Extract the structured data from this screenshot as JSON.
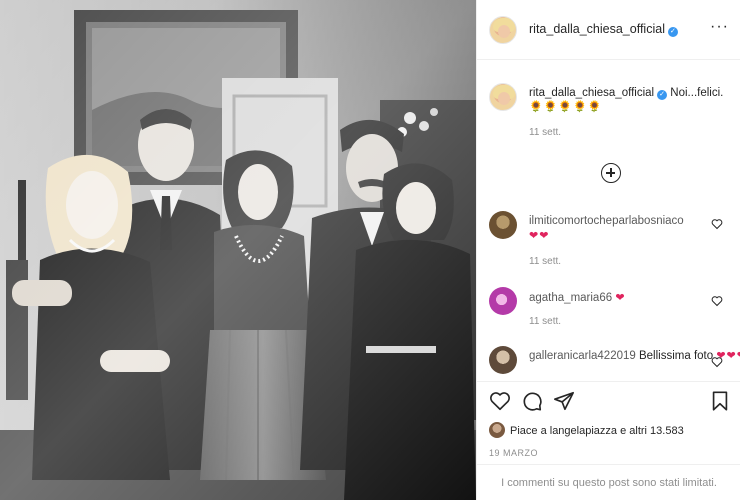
{
  "post": {
    "photo_alt_subjects": "",
    "header": {
      "username": "rita_dalla_chiesa_official",
      "more_icon": "more-horizontal-icon"
    },
    "caption": {
      "username": "rita_dalla_chiesa_official",
      "text": "Noi...felici.",
      "emoji": "🌻🌻🌻🌻🌻",
      "time": "11 sett."
    },
    "load_more_icon": "plus-circle-icon",
    "comments": [
      {
        "username": "ilmiticomortocheparlabosniaco",
        "text": "",
        "hearts": "❤❤",
        "time": "11 sett."
      },
      {
        "username": "agatha_maria66",
        "text": "",
        "hearts": "❤",
        "time": "11 sett."
      },
      {
        "username": "galleranicarla422019",
        "text": "Bellissima foto",
        "hearts": "❤❤❤❤",
        "time": ""
      }
    ],
    "actions": {
      "like_icon": "heart-outline-icon",
      "comment_icon": "comment-bubble-icon",
      "share_icon": "paper-plane-icon",
      "save_icon": "bookmark-icon"
    },
    "likes": {
      "prefix": "Piace a ",
      "user": "langelapiazza",
      "suffix": " e altri 13.583"
    },
    "date": "19 MARZO",
    "comments_limited": "I commenti su questo post sono stati limitati."
  },
  "colors": {
    "verified": "#3897f0",
    "heart": "#e0245e",
    "muted_text": "#8e8e8e",
    "border": "#efefef"
  }
}
